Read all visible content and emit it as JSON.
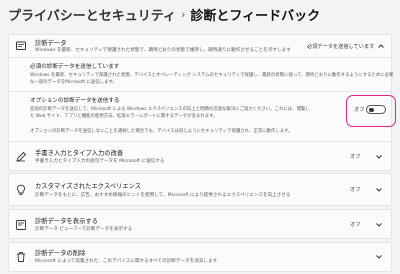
{
  "breadcrumb": {
    "parent": "プライバシーとセキュリティ",
    "separator": "›",
    "current": "診断とフィードバック"
  },
  "diagnostic_data": {
    "title": "診断データ",
    "desc": "Windows を最新、セキュリティで保護された状態で、期待どおりの状態で維持し、期待通りに動作させることを示すします",
    "status": "必須データを送信しています",
    "icon": "diagnostic-icon"
  },
  "required": {
    "title": "必須の診断データを送信しています",
    "desc_line1": "Windows を最新、セキュリティで保護された状態、デバイスとオペレーティング システムのセキュリティで保護し、最新の状態に保って、期待どおりに動作するようにするために必要",
    "desc_line2": "な一部のデータをMicrosoft に送信します。"
  },
  "optional": {
    "title": "オプションの診断データを送信する",
    "desc_line1": "追加の診断データを送信して、Microsoft による Windows エクスペリエンスの向上と問題の迅速な解決にご協力ください。これには、閲覧し",
    "desc_line2": "た Web サイト、アプリと機能の使用方法、拡張エラーレポートに関するデータが含まれます。",
    "desc_line3": "オプションの診断データを送信しないことを選択した場合でも、デバイスは同じようにセキュリティで保護され、正常に動作します。",
    "toggle_label": "オフ",
    "toggle_state": "off",
    "highlight_color": "#e8208a"
  },
  "ink_typing": {
    "title": "手書き入力とタイプ入力の改善",
    "desc": "手書き入力とタイプ入力の語句データを Microsoft に送信する",
    "status": "オフ",
    "icon": "pen-icon"
  },
  "tailored": {
    "title": "カスタマイズされたエクスペリエンス",
    "desc": "診断データをもとに、広告、おすすめ情報のヒントを使用して、Microsoft により提供されるエクスペリエンスを向上させる",
    "status": "オフ",
    "icon": "lightbulb-icon"
  },
  "view_data": {
    "title": "診断データを表示する",
    "desc": "診断データ ビューアーで診断データを表示する",
    "status": "オフ",
    "icon": "document-search-icon"
  },
  "delete_data": {
    "title": "診断データの削除",
    "desc": "Microsoft によって収集された、このデバイスに関するすべての診断データを消去します",
    "icon": "trash-icon"
  }
}
